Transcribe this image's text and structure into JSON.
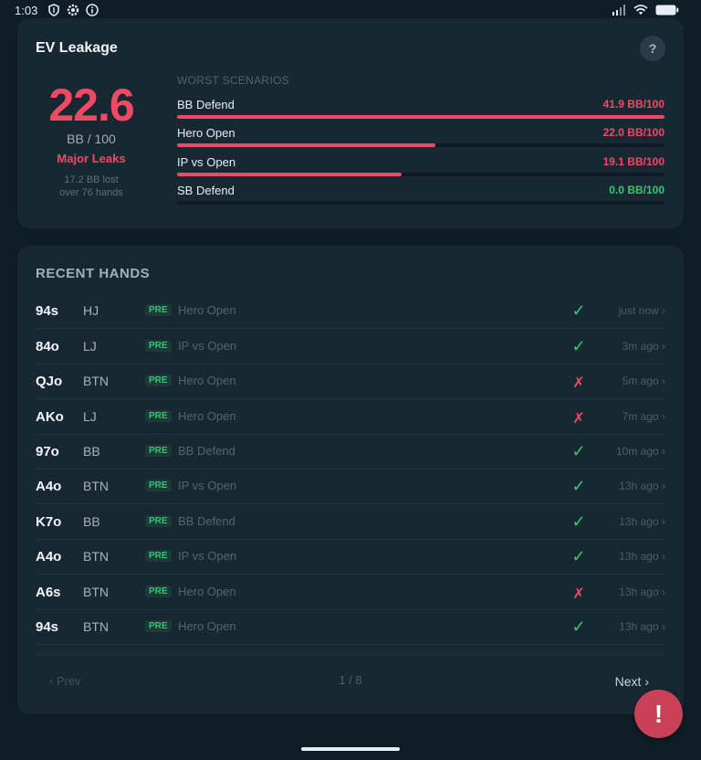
{
  "status_bar": {
    "time": "1:03",
    "left_icons": [
      "shield-icon",
      "settings-icon",
      "info-icon"
    ],
    "right_icons": [
      "signal-icon",
      "wifi-icon",
      "battery-icon"
    ]
  },
  "ev_card": {
    "title": "EV Leakage",
    "help_label": "?",
    "value": "22.6",
    "unit": "BB / 100",
    "status": "Major Leaks",
    "lost_text": "17.2 BB lost",
    "hands_text": "over 76 hands",
    "worst_title": "WORST SCENARIOS",
    "scenarios": [
      {
        "name": "BB Defend",
        "value": "41.9 BB/100",
        "level": 1.0,
        "color": "#ef4a64"
      },
      {
        "name": "Hero Open",
        "value": "22.0 BB/100",
        "level": 0.53,
        "color": "#ef4a64"
      },
      {
        "name": "IP vs Open",
        "value": "19.1 BB/100",
        "level": 0.46,
        "color": "#ef4a64"
      },
      {
        "name": "SB Defend",
        "value": "0.0 BB/100",
        "level": 0.0,
        "color": "#2ecc71"
      }
    ]
  },
  "recent_hands": {
    "title": "RECENT HANDS",
    "rows": [
      {
        "hand": "94s",
        "pos": "HJ",
        "street": "PRE",
        "scenario": "Hero Open",
        "result": "correct",
        "symbol": "✓",
        "time": "just now ›"
      },
      {
        "hand": "84o",
        "pos": "LJ",
        "street": "PRE",
        "scenario": "IP vs Open",
        "result": "correct",
        "symbol": "✓",
        "time": "3m ago ›"
      },
      {
        "hand": "QJo",
        "pos": "BTN",
        "street": "PRE",
        "scenario": "Hero Open",
        "result": "wrong",
        "symbol": "✗",
        "time": "5m ago ›"
      },
      {
        "hand": "AKo",
        "pos": "LJ",
        "street": "PRE",
        "scenario": "Hero Open",
        "result": "wrong",
        "symbol": "✗",
        "time": "7m ago ›"
      },
      {
        "hand": "97o",
        "pos": "BB",
        "street": "PRE",
        "scenario": "BB Defend",
        "result": "correct",
        "symbol": "✓",
        "time": "10m ago ›"
      },
      {
        "hand": "A4o",
        "pos": "BTN",
        "street": "PRE",
        "scenario": "IP vs Open",
        "result": "correct",
        "symbol": "✓",
        "time": "13h ago ›"
      },
      {
        "hand": "K7o",
        "pos": "BB",
        "street": "PRE",
        "scenario": "BB Defend",
        "result": "correct",
        "symbol": "✓",
        "time": "13h ago ›"
      },
      {
        "hand": "A4o",
        "pos": "BTN",
        "street": "PRE",
        "scenario": "IP vs Open",
        "result": "correct",
        "symbol": "✓",
        "time": "13h ago ›"
      },
      {
        "hand": "A6s",
        "pos": "BTN",
        "street": "PRE",
        "scenario": "Hero Open",
        "result": "wrong",
        "symbol": "✗",
        "time": "13h ago ›"
      },
      {
        "hand": "94s",
        "pos": "BTN",
        "street": "PRE",
        "scenario": "Hero Open",
        "result": "correct",
        "symbol": "✓",
        "time": "13h ago ›"
      }
    ],
    "pagination": {
      "prev": "‹ Prev",
      "page_indicator": "1 / 8",
      "next": "Next ›"
    }
  },
  "fab_label": "!",
  "colors": {
    "accent_red": "#ef4a64",
    "accent_green": "#2ecc71",
    "card_bg": "#182833",
    "page_bg": "#0f1d27"
  }
}
